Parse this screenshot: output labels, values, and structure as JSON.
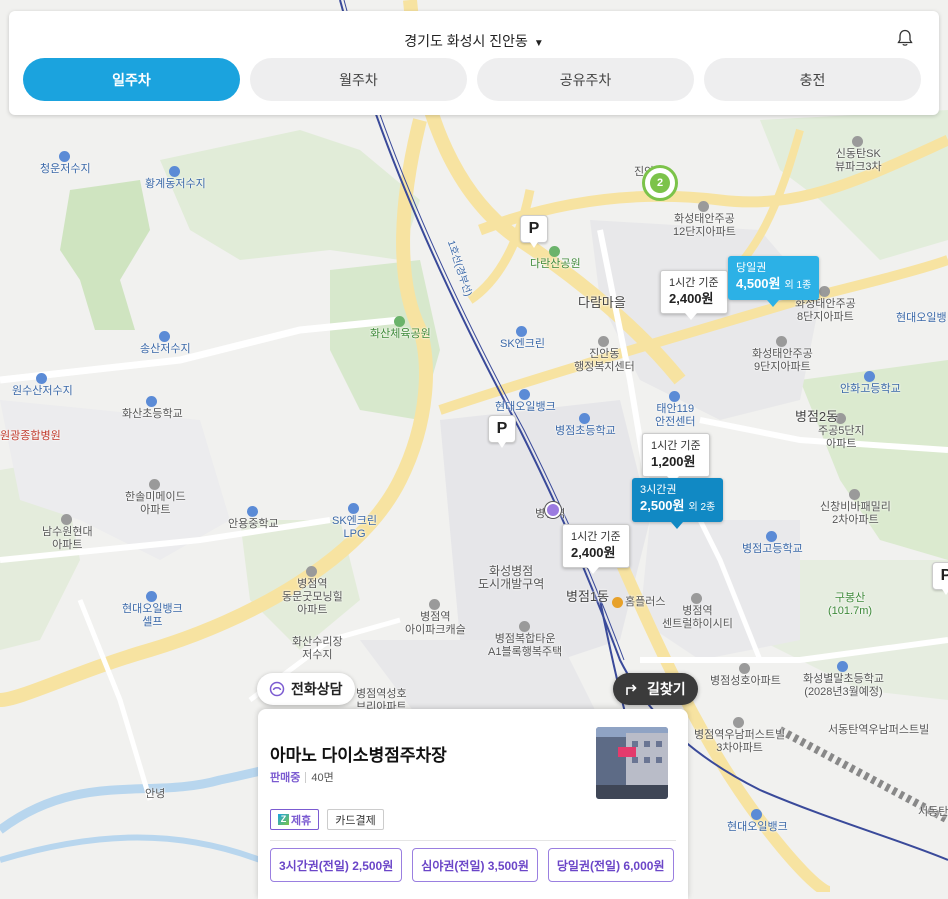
{
  "header": {
    "location": "경기도 화성시 진안동",
    "tabs": [
      {
        "label": "일주차",
        "active": true
      },
      {
        "label": "월주차",
        "active": false
      },
      {
        "label": "공유주차",
        "active": false
      },
      {
        "label": "충전",
        "active": false
      }
    ]
  },
  "map": {
    "labels": {
      "cheongun": "청운저수지",
      "hwanggye": "황계동저수지",
      "songsan": "송산저수지",
      "wonsusan": "원수산저수지",
      "wongwang": "원광종합병원",
      "hwasan_elem": "화산초등학교",
      "hanmi": "한솔미메이드\n아파트",
      "namsuwon": "남수원현대\n아파트",
      "anyong_mid": "안용중학교",
      "sk_lpg": "SK엔크린\nLPG",
      "hyundai_self": "현대오일뱅크\n셀프",
      "byeongjeom_dongmun": "병점역\n동문굿모닝힐\n아파트",
      "hwasan_suri": "화산수리장\n저수지",
      "byeongjeom_seongho": "병점역성호\n브리아파트",
      "ansu": "안녕",
      "dalan": "다란산공원",
      "hwasan_sports": "화산체육공원",
      "sk_enclean": "SK엔크린",
      "jinan_welfare": "진안동\n행정복지센터",
      "hyundai_oil": "현대오일뱅크",
      "damaeul": "다람마을",
      "jinan_station": "진안동",
      "byeongjeom_elem": "병점초등학교",
      "taean119": "태안119\n안전센터",
      "byeongjeom_station": "병점역",
      "hwaseong_dev": "화성병점\n도시개발구역",
      "byeongjeom_ipark": "병점역\n아이파크캐슬",
      "byeongjeom_taun": "병점복합타운\nA1블록행복주택",
      "byeongjeom1": "병점1동",
      "homeplus": "홈플러스",
      "central_city": "병점역\n센트럴하이시티",
      "byeongjeom_seongho_apt": "병점성호아파트",
      "haengbok_2028": "화성별말초등학교\n(2028년3월예정)",
      "seodong_first": "병점역우남퍼스트빌\n3차아파트",
      "hyundai_oil2": "현대오일뱅크",
      "seodongtan_first": "서동탄역우남퍼스트빌",
      "taean12": "화성태안주공\n12단지아파트",
      "taean8": "화성태안주공\n8단지아파트",
      "taean9": "화성태안주공\n9단지아파트",
      "taean5": "주공5단지\n아파트",
      "shindong_sk": "신동탄SK\n뷰파크3차",
      "anhwa_high": "안화고등학교",
      "byeongjeom2": "병점2동",
      "byeongjeom_high": "병점고등학교",
      "sinchang": "신창비바패밀리\n2차아파트",
      "gubongsan": "구봉산\n(101.7m)",
      "hyundai_oil3": "현대오일뱅",
      "byeongjeom_line": "1호선(경부선)",
      "seodong": "서동탄"
    }
  },
  "markers": {
    "p1": "P",
    "p2": "P",
    "p3": "P",
    "ev_count": "2",
    "price_a": {
      "sub": "1시간 기준",
      "val": "2,400원"
    },
    "price_b": {
      "sub": "당일권",
      "val": "4,500원",
      "extra": "외 1종"
    },
    "price_c": {
      "sub": "1시간 기준",
      "val": "1,200원"
    },
    "price_d": {
      "sub": "3시간권",
      "val": "2,500원",
      "extra": "외 2종"
    },
    "price_e": {
      "sub": "1시간 기준",
      "val": "2,400원"
    }
  },
  "actions": {
    "call": "전화상담",
    "route": "길찾기"
  },
  "card": {
    "title": "아마노 다이소병점주차장",
    "status": "판매중",
    "spots": "40면",
    "badges": [
      "제휴",
      "카드결제"
    ],
    "tickets": [
      "3시간권(전일) 2,500원",
      "심야권(전일) 3,500원",
      "당일권(전일) 6,000원"
    ]
  }
}
